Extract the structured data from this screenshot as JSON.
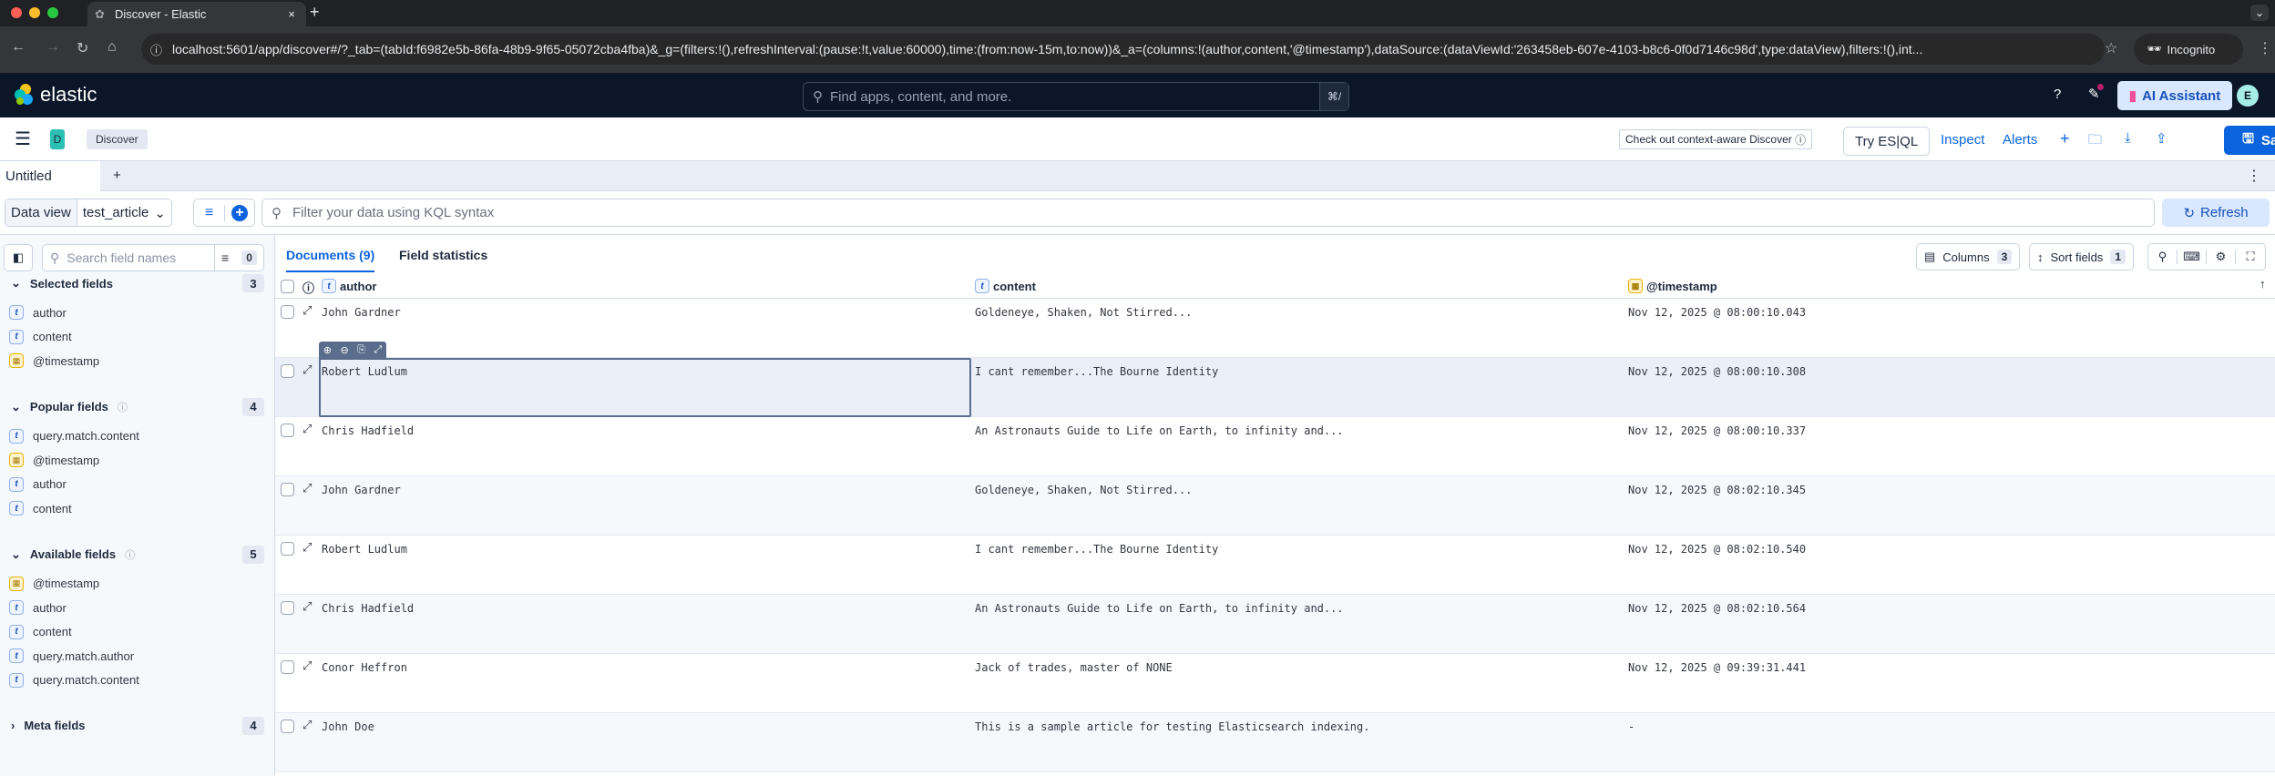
{
  "browser": {
    "tab_title": "Discover - Elastic",
    "url": "localhost:5601/app/discover#/?_tab=(tabId:f6982e5b-86fa-48b9-9f65-05072cba4fba)&_g=(filters:!(),refreshInterval:(pause:!t,value:60000),time:(from:now-15m,to:now))&_a=(columns:!(author,content,'@timestamp'),dataSource:(dataViewId:'263458eb-607e-4103-b8c6-0f0d7146c98d',type:dataView),filters:!(),int...",
    "incognito": "Incognito",
    "colors": {
      "close": "#ff5f57",
      "min": "#febc2e",
      "max": "#28c840"
    }
  },
  "header": {
    "logo": "elastic",
    "search_placeholder": "Find apps, content, and more.",
    "shortcut": "⌘/",
    "ai_assistant": "AI Assistant",
    "avatar": "E"
  },
  "app": {
    "space": "D",
    "breadcrumb": "Discover",
    "context_aware": "Check out context-aware Discover",
    "try_esql": "Try ES|QL",
    "inspect": "Inspect",
    "alerts": "Alerts",
    "save": "Save",
    "accent": "#0b64dd"
  },
  "tabs": {
    "current": "Untitled",
    "add": "+"
  },
  "query": {
    "data_view_label": "Data view",
    "data_view": "test_article",
    "placeholder": "Filter your data using KQL syntax",
    "refresh": "Refresh"
  },
  "sidebar": {
    "search_placeholder": "Search field names",
    "filter_count": "0",
    "sections": [
      {
        "title": "Selected fields",
        "count": "3",
        "expanded": true,
        "fields": [
          {
            "name": "author",
            "type": "t"
          },
          {
            "name": "content",
            "type": "t"
          },
          {
            "name": "@timestamp",
            "type": "date"
          }
        ]
      },
      {
        "title": "Popular fields",
        "count": "4",
        "expanded": true,
        "fields": [
          {
            "name": "query.match.content",
            "type": "t"
          },
          {
            "name": "@timestamp",
            "type": "date"
          },
          {
            "name": "author",
            "type": "t"
          },
          {
            "name": "content",
            "type": "t"
          }
        ]
      },
      {
        "title": "Available fields",
        "count": "5",
        "expanded": true,
        "fields": [
          {
            "name": "@timestamp",
            "type": "date"
          },
          {
            "name": "author",
            "type": "t"
          },
          {
            "name": "content",
            "type": "t"
          },
          {
            "name": "query.match.author",
            "type": "t"
          },
          {
            "name": "query.match.content",
            "type": "t"
          }
        ]
      },
      {
        "title": "Meta fields",
        "count": "4",
        "expanded": false,
        "fields": []
      }
    ]
  },
  "main": {
    "tab_documents": "Documents (9)",
    "tab_field_stats": "Field statistics",
    "columns_label": "Columns",
    "columns_count": "3",
    "sort_label": "Sort fields",
    "sort_count": "1",
    "headers": [
      "author",
      "content",
      "@timestamp"
    ],
    "rows": [
      [
        "John Gardner",
        "Goldeneye, Shaken, Not Stirred...",
        "Nov 12, 2025 @ 08:00:10.043"
      ],
      [
        "Robert Ludlum",
        "I cant remember...The Bourne Identity",
        "Nov 12, 2025 @ 08:00:10.308"
      ],
      [
        "Chris Hadfield",
        "An Astronauts Guide to Life on Earth, to infinity and...",
        "Nov 12, 2025 @ 08:00:10.337"
      ],
      [
        "John Gardner",
        "Goldeneye, Shaken, Not Stirred...",
        "Nov 12, 2025 @ 08:02:10.345"
      ],
      [
        "Robert Ludlum",
        "I cant remember...The Bourne Identity",
        "Nov 12, 2025 @ 08:02:10.540"
      ],
      [
        "Chris Hadfield",
        "An Astronauts Guide to Life on Earth, to infinity and...",
        "Nov 12, 2025 @ 08:02:10.564"
      ],
      [
        "Conor Heffron",
        "Jack of trades, master of NONE",
        "Nov 12, 2025 @ 09:39:31.441"
      ],
      [
        "John Doe",
        "This is a sample article for testing Elasticsearch indexing.",
        "-"
      ]
    ]
  }
}
